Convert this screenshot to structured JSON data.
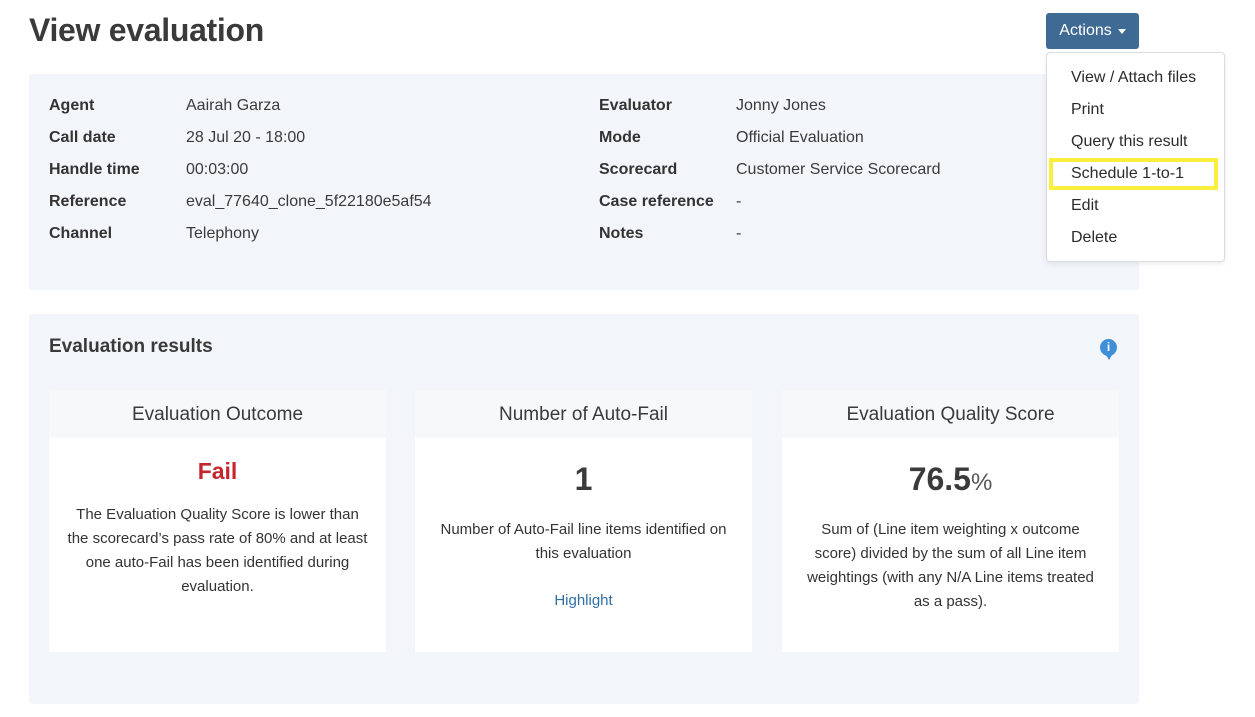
{
  "page": {
    "title": "View evaluation"
  },
  "actions": {
    "label": "Actions",
    "items": [
      "View / Attach files",
      "Print",
      "Query this result",
      "Schedule 1-to-1",
      "Edit",
      "Delete"
    ]
  },
  "details": {
    "left": [
      {
        "label": "Agent",
        "value": "Aairah Garza"
      },
      {
        "label": "Call date",
        "value": "28 Jul 20 - 18:00"
      },
      {
        "label": "Handle time",
        "value": "00:03:00"
      },
      {
        "label": "Reference",
        "value": "eval_77640_clone_5f22180e5af54"
      },
      {
        "label": "Channel",
        "value": "Telephony"
      }
    ],
    "right": [
      {
        "label": "Evaluator",
        "value": "Jonny Jones"
      },
      {
        "label": "Mode",
        "value": "Official Evaluation"
      },
      {
        "label": "Scorecard",
        "value": "Customer Service Scorecard"
      },
      {
        "label": "Case reference",
        "value": "-"
      },
      {
        "label": "Notes",
        "value": "-"
      }
    ]
  },
  "results": {
    "title": "Evaluation results",
    "info_icon": "i",
    "cards": [
      {
        "title": "Evaluation Outcome",
        "value": "Fail",
        "description": "The Evaluation Quality Score is lower than the scorecard’s pass rate of 80% and at least one auto-Fail has been identified during evaluation."
      },
      {
        "title": "Number of Auto-Fail",
        "value": "1",
        "description": "Number of Auto-Fail line items identified on this evaluation",
        "link": "Highlight"
      },
      {
        "title": "Evaluation Quality Score",
        "value": "76.5",
        "unit": "%",
        "description": "Sum of (Line item weighting x outcome score) divided by the sum of all Line item weightings (with any N/A Line items treated as a pass)."
      }
    ]
  },
  "colors": {
    "primary": "#3f6a93",
    "fail": "#c4262e",
    "link": "#2f6ea6",
    "highlight": "#fbef3d",
    "panel": "#f2f6fa"
  }
}
